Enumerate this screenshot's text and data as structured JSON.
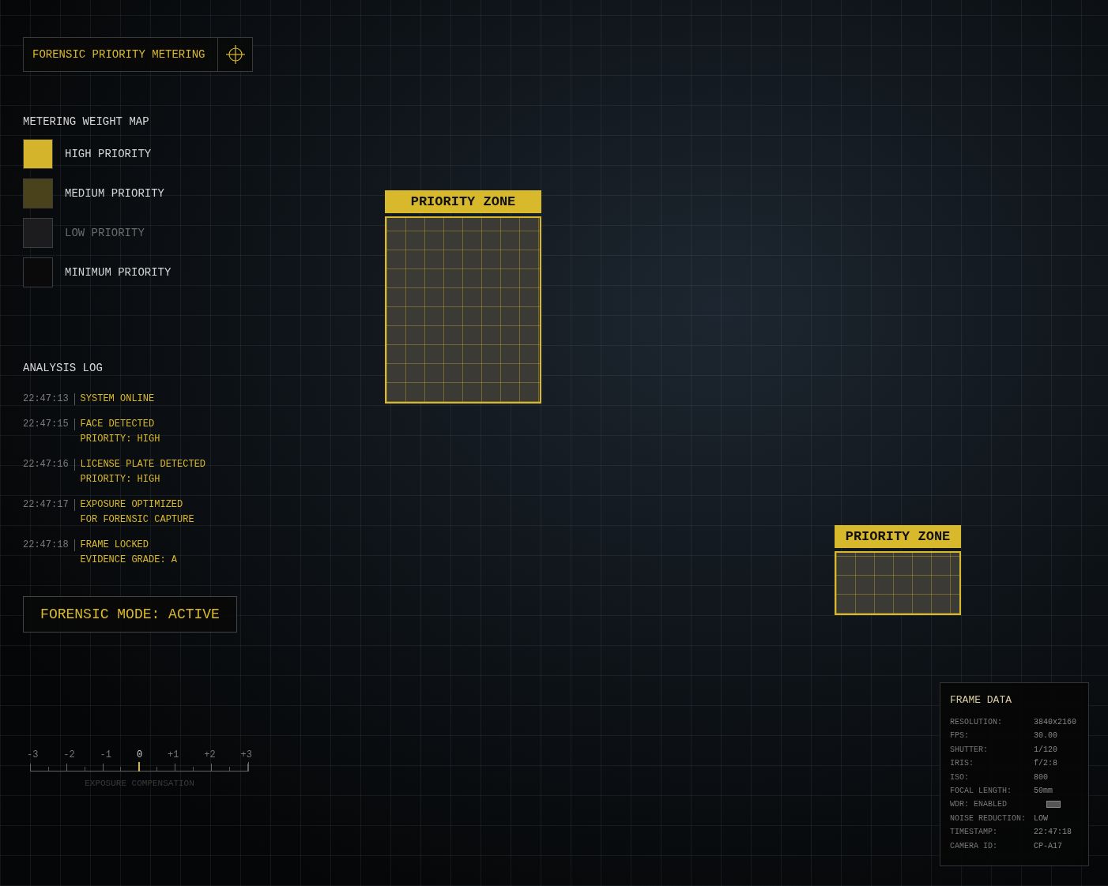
{
  "header": {
    "title": "FORENSIC PRIORITY METERING"
  },
  "weight_map": {
    "title": "METERING WEIGHT MAP",
    "items": [
      {
        "label": "HIGH PRIORITY",
        "color": "#d4b42a"
      },
      {
        "label": "MEDIUM PRIORITY",
        "color": "#4a421a"
      },
      {
        "label": "LOW PRIORITY",
        "color": "#1c1c1e"
      },
      {
        "label": "MINIMUM PRIORITY",
        "color": "#0a0a0b"
      }
    ]
  },
  "zones": [
    {
      "label": "PRIORITY ZONE"
    },
    {
      "label": "PRIORITY ZONE"
    }
  ],
  "analysis_log": {
    "title": "ANALYSIS LOG",
    "entries": [
      {
        "time": "22:47:13",
        "lines": [
          "SYSTEM ONLINE"
        ]
      },
      {
        "time": "22:47:15",
        "lines": [
          "FACE DETECTED",
          "PRIORITY: HIGH"
        ]
      },
      {
        "time": "22:47:16",
        "lines": [
          "LICENSE PLATE DETECTED",
          "PRIORITY: HIGH"
        ]
      },
      {
        "time": "22:47:17",
        "lines": [
          "EXPOSURE OPTIMIZED",
          "FOR FORENSIC CAPTURE"
        ]
      },
      {
        "time": "22:47:18",
        "lines": [
          "FRAME LOCKED",
          "EVIDENCE GRADE: A"
        ]
      }
    ]
  },
  "mode_status": "FORENSIC MODE: ACTIVE",
  "exposure_scale": {
    "ticks": [
      "-3",
      "-2",
      "-1",
      "0",
      "+1",
      "+2",
      "+3"
    ],
    "level": 0.5,
    "caption": "EXPOSURE COMPENSATION"
  },
  "frame_data": {
    "title": "FRAME DATA",
    "rows": [
      {
        "kind": "text",
        "label": "RESOLUTION:",
        "value": "3840x2160"
      },
      {
        "kind": "text",
        "label": "FPS:",
        "value": "30.00"
      },
      {
        "kind": "text",
        "label": "SHUTTER:",
        "value": "1/120"
      },
      {
        "kind": "text",
        "label": "IRIS:",
        "value": "f/2:8"
      },
      {
        "kind": "text",
        "label": "ISO:",
        "value": "800"
      },
      {
        "kind": "text",
        "label": "FOCAL LENGTH:",
        "value": "50mm"
      },
      {
        "kind": "icon",
        "label": "WDR: ENABLED"
      },
      {
        "kind": "text",
        "label": "NOISE REDUCTION:",
        "value": "LOW"
      },
      {
        "kind": "text",
        "label": "TIMESTAMP:",
        "value": "22:47:18"
      },
      {
        "kind": "text",
        "label": "CAMERA ID:",
        "value": "CP-A17"
      }
    ]
  }
}
